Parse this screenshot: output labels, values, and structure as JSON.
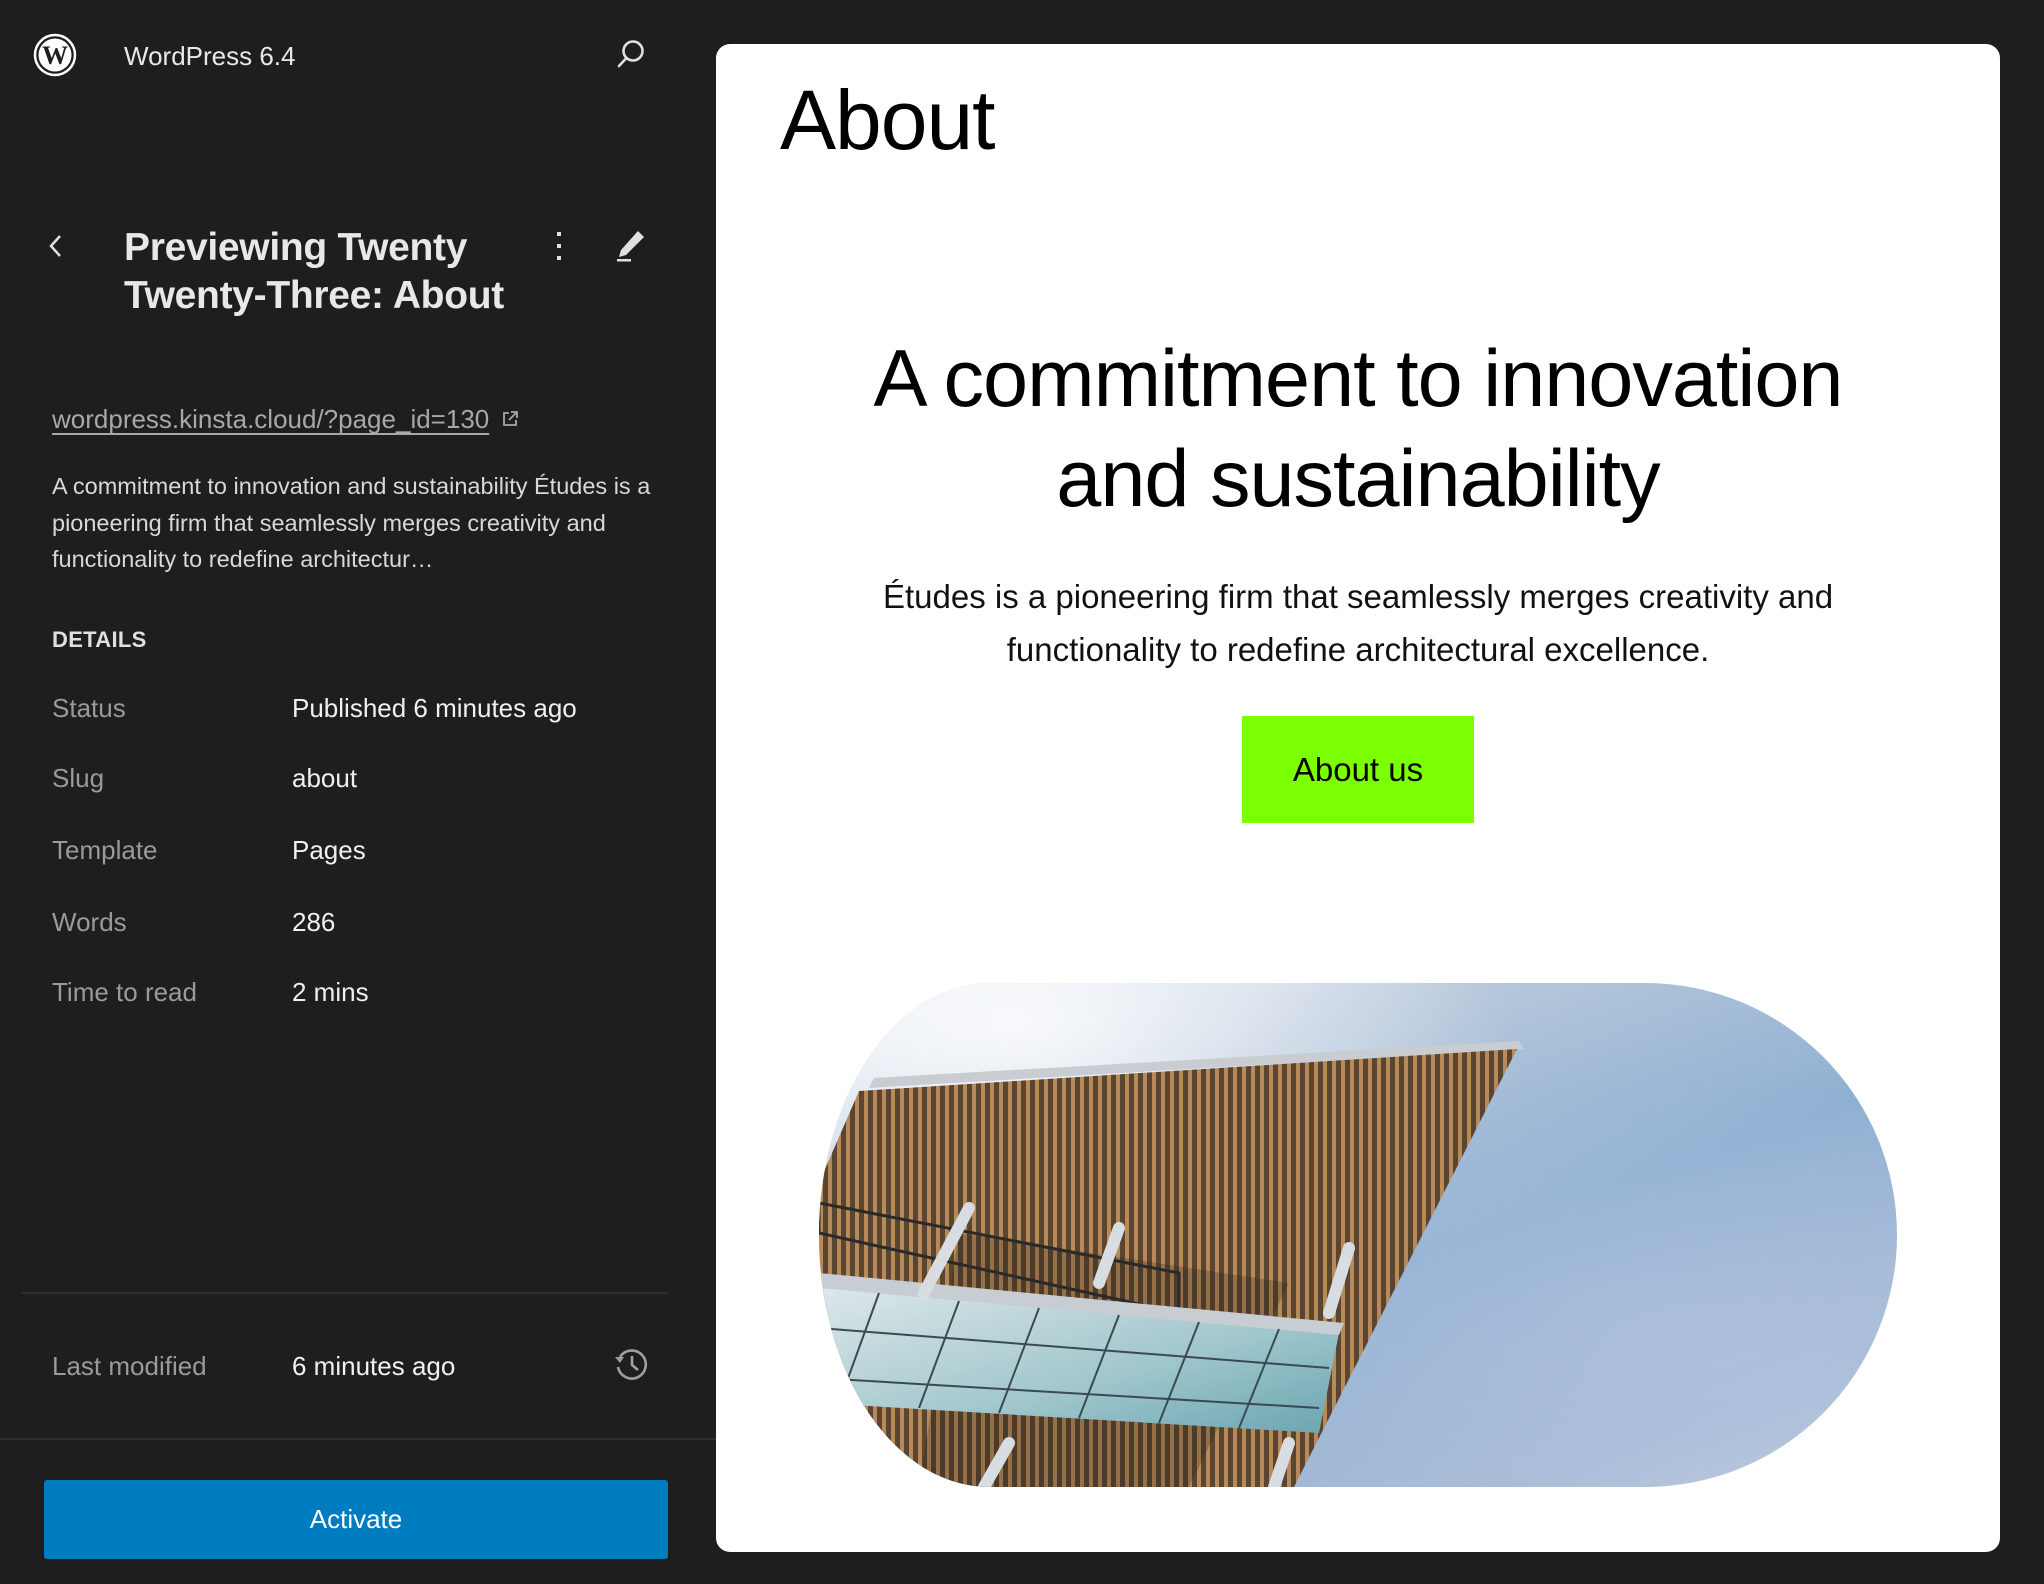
{
  "header": {
    "logo_icon": "wordpress-logo-icon",
    "site_title": "WordPress 6.4",
    "search_icon": "search-icon"
  },
  "panel": {
    "back_icon": "chevron-left-icon",
    "title": "Previewing Twenty Twenty-Three: About",
    "more_icon": "more-vertical-icon",
    "edit_icon": "pencil-icon",
    "url": "wordpress.kinsta.cloud/?page_id=130",
    "url_icon": "external-link-icon",
    "description": "A commitment to innovation and sustainability Études is a pioneering firm that seamlessly merges creativity and functionality to redefine architectur…",
    "details_heading": "DETAILS",
    "details": [
      {
        "label": "Status",
        "value": "Published 6 minutes ago"
      },
      {
        "label": "Slug",
        "value": "about"
      },
      {
        "label": "Template",
        "value": "Pages"
      },
      {
        "label": "Words",
        "value": "286"
      },
      {
        "label": "Time to read",
        "value": "2 mins"
      }
    ],
    "last_modified": {
      "label": "Last modified",
      "value": "6 minutes ago",
      "icon": "history-icon"
    },
    "activate_label": "Activate"
  },
  "preview": {
    "page_title": "About",
    "hero_heading": "A commitment to innovation and sustainability",
    "hero_paragraph": "Études is a pioneering firm that seamlessly merges creativity and functionality to redefine architectural excellence.",
    "button_label": "About us",
    "image_alt": "building-facade-against-sky"
  },
  "colors": {
    "sidebar_bg": "#1e1e1e",
    "accent_blue": "#007cc1",
    "button_green": "#7aff03",
    "preview_bg": "#ffffff"
  }
}
